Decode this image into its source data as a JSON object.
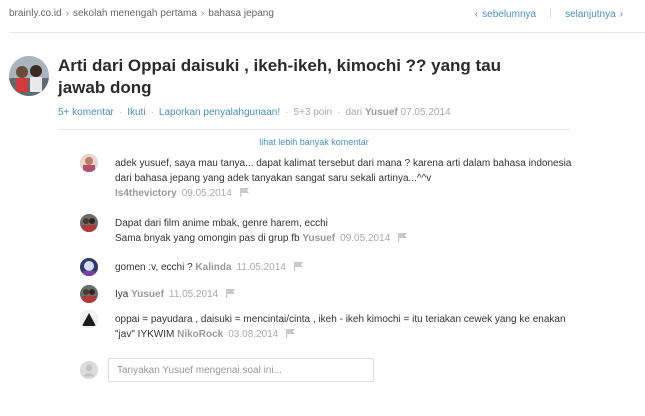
{
  "breadcrumb": {
    "items": [
      "brainly.co.id",
      "sekolah menengah pertama",
      "bahasa jepang"
    ],
    "separator": "›"
  },
  "pager": {
    "prev_label": "sebelumnya",
    "next_label": "selanjutnya"
  },
  "question": {
    "title": "Arti dari Oppai daisuki , ikeh-ikeh, kimochi ?? yang tau jawab dong",
    "comments_link": "5+ komentar",
    "follow_link": "Ikuti",
    "report_link": "Laporkan penyalahgunaan!",
    "points": "5+3 poin",
    "from_label": "dari",
    "author": "Yusuef",
    "date": "07.05.2014"
  },
  "more_comments_link": "lihat lebih banyak komentar",
  "comments": [
    {
      "text": "adek yusuef, saya mau tanya... dapat kalimat tersebut dari mana ? karena arti dalam bahasa indonesia dari bahasa jepang yang adek tanyakan sangat saru sekali artinya...^^v",
      "user": "Is4thevictory",
      "date": "09.05.2014"
    },
    {
      "text": "Dapat dari film anime mbak, genre harem, ecchi\nSama bnyak yang omongin pas di grup fb",
      "user": "Yusuef",
      "date": "09.05.2014"
    },
    {
      "text": "gomen :v, ecchi ?",
      "user": "Kalinda",
      "date": "11.05.2014"
    },
    {
      "text": "Iya",
      "user": "Yusuef",
      "date": "11.05.2014"
    },
    {
      "text": "oppai = payudara , daisuki = mencintai/cinta , ikeh - ikeh kimochi = itu teriakan cewek yang ke enakan \"jav\" IYKWIM",
      "user": "NikoRock",
      "date": "03.08.2014"
    }
  ],
  "reply": {
    "placeholder": "Tanyakan Yusuef mengenai soal ini..."
  },
  "colors": {
    "link": "#4a90c2",
    "title": "#2b2b2b",
    "muted": "#aaaaaa"
  },
  "icons": [
    "chevron-left-icon",
    "chevron-right-icon",
    "flag-icon"
  ]
}
